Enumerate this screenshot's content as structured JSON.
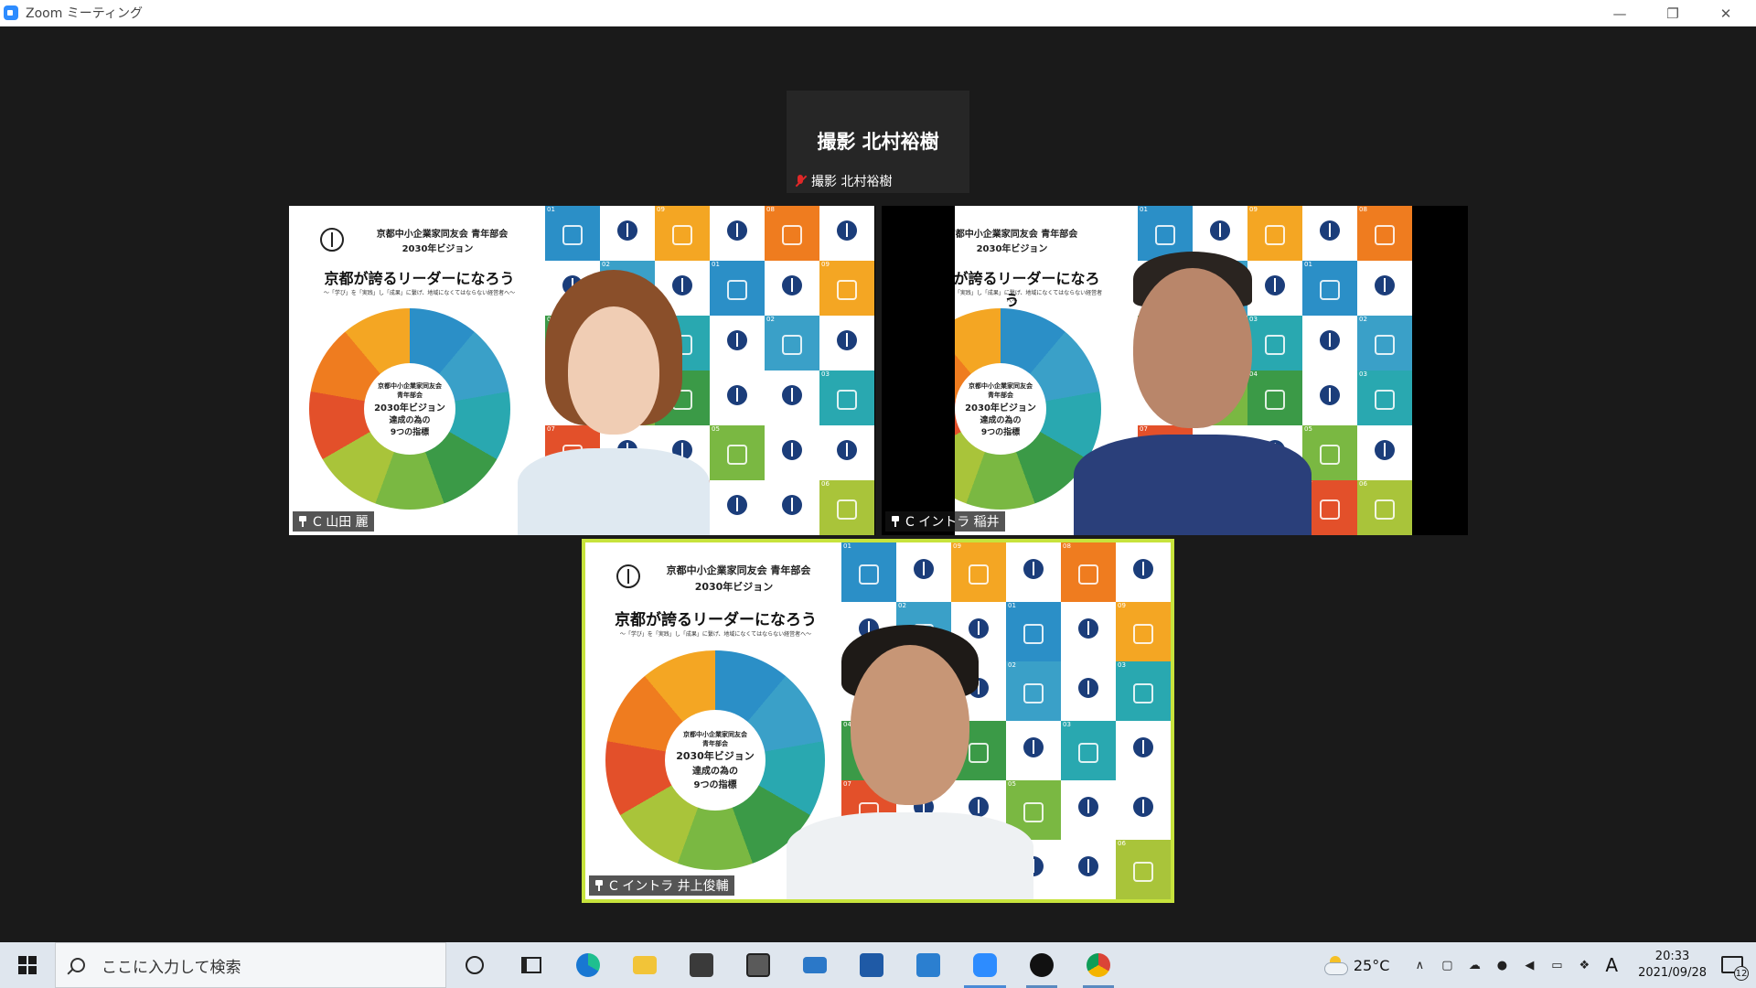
{
  "window": {
    "title": "Zoom ミーティング"
  },
  "active_speaker": {
    "display_name": "撮影 北村裕樹",
    "label": "撮影 北村裕樹",
    "muted": true
  },
  "slide": {
    "org_line": "京都中小企業家同友会 青年部会",
    "year_line": "2030年ビジョン",
    "title": "京都が誇るリーダーになろう",
    "subtitle": "〜「学び」を「実践」し「成果」に繋げ、地域になくてはならない経営者へ〜",
    "center_lines": [
      "京都中小企業家同友会",
      "青年部会",
      "2030年ビジョン",
      "達成の為の",
      "9つの指標"
    ]
  },
  "participants": [
    {
      "name": "C 山田 麗",
      "pinned": true
    },
    {
      "name": "C イントラ 稲井",
      "pinned": true
    },
    {
      "name": "C イントラ 井上俊輔",
      "pinned": true,
      "speaking": true
    }
  ],
  "colors": {
    "wheel": [
      "#2b8fc7",
      "#3aa0c8",
      "#29a8b0",
      "#3b9a47",
      "#7ab842",
      "#a9c43a",
      "#e3502a",
      "#ef7c1f",
      "#f4a623"
    ],
    "grid_alt": "#ffffff",
    "speaking_border": "#c7e33c"
  },
  "taskbar": {
    "search_placeholder": "ここに入力して検索",
    "temperature": "25°C",
    "ime": "A",
    "time": "20:33",
    "date": "2021/09/28",
    "notification_count": "12"
  }
}
